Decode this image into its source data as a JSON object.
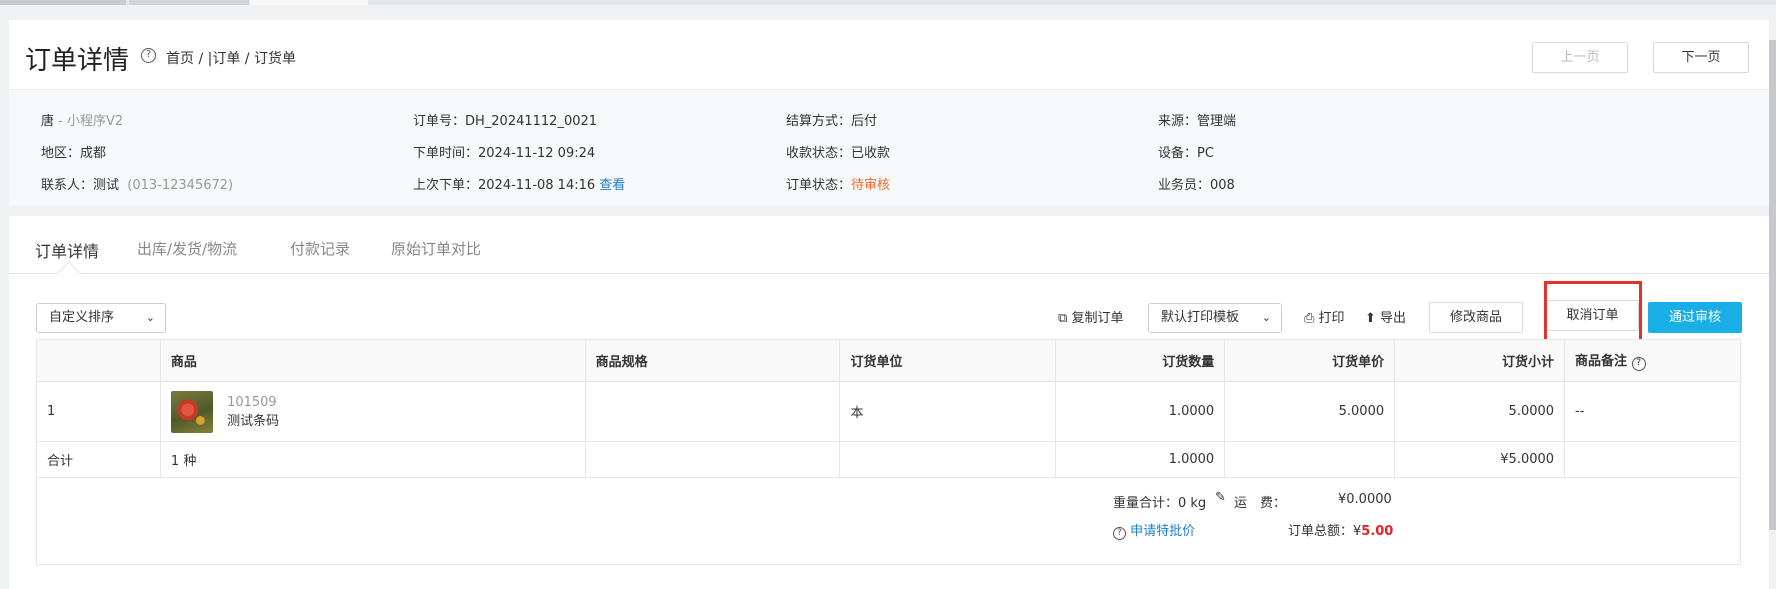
{
  "header": {
    "title": "订单详情",
    "breadcrumb": "首页 / |订单 / 订货单",
    "prev_label": "上一页",
    "next_label": "下一页"
  },
  "info": {
    "customer": "唐",
    "channel": " - 小程序V2",
    "region": "地区：成都",
    "contact": "联系人：测试",
    "phone": "(013-12345672)",
    "order_no": "订单号：DH_20241112_0021",
    "order_time": "下单时间：2024-11-12 09:24",
    "last_order": "上次下单：2024-11-08 14:16",
    "view_link": "查看",
    "settlement": "结算方式：后付",
    "payment_status": "收款状态：已收款",
    "order_status_label": "订单状态：",
    "order_status_value": "待审核",
    "source": "来源：管理端",
    "device": "设备：PC",
    "salesperson": "业务员：008"
  },
  "tabs": [
    "订单详情",
    "出库/发货/物流",
    "付款记录",
    "原始订单对比"
  ],
  "toolbar": {
    "sort_select": "自定义排序",
    "copy_order": "复制订单",
    "print_template": "默认打印模板",
    "print": "打印",
    "export": "导出",
    "edit_goods": "修改商品",
    "cancel_order": "取消订单",
    "approve": "通过审核"
  },
  "table": {
    "headers": [
      "",
      "商品",
      "商品规格",
      "订货单位",
      "订货数量",
      "订货单价",
      "订货小计",
      "商品备注"
    ],
    "rows": [
      {
        "index": "1",
        "code": "101509",
        "name": "测试条码",
        "spec": "",
        "unit": "本",
        "qty": "1.0000",
        "price": "5.0000",
        "subtotal": "5.0000",
        "remark": "--"
      }
    ],
    "total": {
      "label": "合计",
      "kinds": "1 种",
      "qty": "1.0000",
      "subtotal": "¥5.0000"
    }
  },
  "summary": {
    "weight": "重量合计：0 kg",
    "freight_label": "运　费：",
    "freight_value": "¥0.0000",
    "special_price": "申请特批价",
    "total_label": "订单总额：¥",
    "total_value": "5.00"
  },
  "colors": {
    "primary": "#1aaee6",
    "link": "#1f7fd1",
    "pending": "#f26b2c",
    "highlight": "#e8302a",
    "amount": "#e8202b"
  }
}
